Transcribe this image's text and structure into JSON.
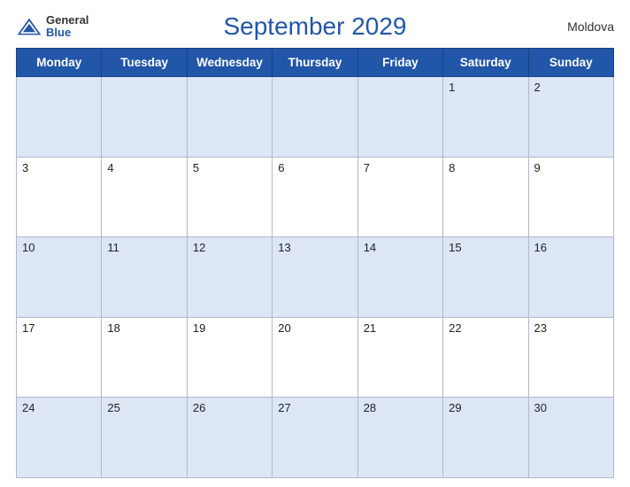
{
  "header": {
    "logo_general": "General",
    "logo_blue": "Blue",
    "title": "September 2029",
    "country": "Moldova"
  },
  "weekdays": [
    "Monday",
    "Tuesday",
    "Wednesday",
    "Thursday",
    "Friday",
    "Saturday",
    "Sunday"
  ],
  "weeks": [
    [
      {
        "day": "",
        "empty": true
      },
      {
        "day": "",
        "empty": true
      },
      {
        "day": "",
        "empty": true
      },
      {
        "day": "",
        "empty": true
      },
      {
        "day": "",
        "empty": true
      },
      {
        "day": "1",
        "empty": false
      },
      {
        "day": "2",
        "empty": false
      }
    ],
    [
      {
        "day": "3",
        "empty": false
      },
      {
        "day": "4",
        "empty": false
      },
      {
        "day": "5",
        "empty": false
      },
      {
        "day": "6",
        "empty": false
      },
      {
        "day": "7",
        "empty": false
      },
      {
        "day": "8",
        "empty": false
      },
      {
        "day": "9",
        "empty": false
      }
    ],
    [
      {
        "day": "10",
        "empty": false
      },
      {
        "day": "11",
        "empty": false
      },
      {
        "day": "12",
        "empty": false
      },
      {
        "day": "13",
        "empty": false
      },
      {
        "day": "14",
        "empty": false
      },
      {
        "day": "15",
        "empty": false
      },
      {
        "day": "16",
        "empty": false
      }
    ],
    [
      {
        "day": "17",
        "empty": false
      },
      {
        "day": "18",
        "empty": false
      },
      {
        "day": "19",
        "empty": false
      },
      {
        "day": "20",
        "empty": false
      },
      {
        "day": "21",
        "empty": false
      },
      {
        "day": "22",
        "empty": false
      },
      {
        "day": "23",
        "empty": false
      }
    ],
    [
      {
        "day": "24",
        "empty": false
      },
      {
        "day": "25",
        "empty": false
      },
      {
        "day": "26",
        "empty": false
      },
      {
        "day": "27",
        "empty": false
      },
      {
        "day": "28",
        "empty": false
      },
      {
        "day": "29",
        "empty": false
      },
      {
        "day": "30",
        "empty": false
      }
    ]
  ],
  "colors": {
    "header_bg": "#2256a8",
    "row_odd_bg": "#dce6f5",
    "row_even_bg": "#ffffff"
  }
}
